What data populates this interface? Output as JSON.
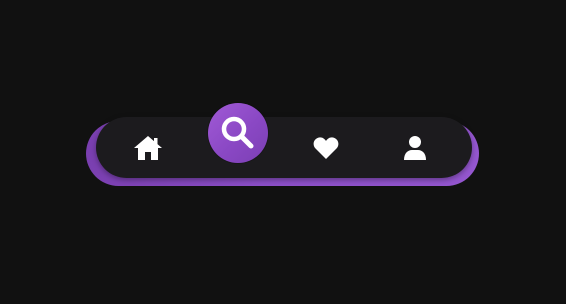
{
  "nav": {
    "active_index": 1,
    "accent_color": "#8a48c4",
    "bar_color": "#1c1b1e",
    "background_color": "#111111",
    "items": [
      {
        "icon": "home-icon",
        "active": false
      },
      {
        "icon": "search-icon",
        "active": true
      },
      {
        "icon": "heart-icon",
        "active": false
      },
      {
        "icon": "user-icon",
        "active": false
      }
    ]
  }
}
